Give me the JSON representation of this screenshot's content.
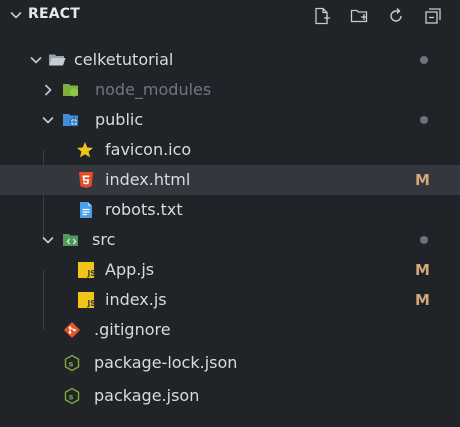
{
  "explorer": {
    "title": "REACT",
    "actions": [
      {
        "name": "new-file-icon"
      },
      {
        "name": "new-folder-icon"
      },
      {
        "name": "refresh-icon"
      },
      {
        "name": "collapse-all-icon"
      }
    ]
  },
  "tree": {
    "root": {
      "label": "celketutorial",
      "icon": "folder-icon",
      "status": "dot"
    },
    "node_modules": {
      "label": "node_modules",
      "icon": "node-folder-icon"
    },
    "public": {
      "label": "public",
      "icon": "public-folder-icon",
      "status": "dot"
    },
    "favicon": {
      "label": "favicon.ico",
      "icon": "star-icon"
    },
    "index_html": {
      "label": "index.html",
      "icon": "html5-icon",
      "badge": "M"
    },
    "robots": {
      "label": "robots.txt",
      "icon": "text-file-icon"
    },
    "src": {
      "label": "src",
      "icon": "src-folder-icon",
      "status": "dot"
    },
    "app_js": {
      "label": "App.js",
      "icon": "javascript-icon",
      "badge": "M",
      "icon_text": "JS"
    },
    "index_js": {
      "label": "index.js",
      "icon": "javascript-icon",
      "badge": "M",
      "icon_text": "JS"
    },
    "gitignore": {
      "label": ".gitignore",
      "icon": "git-icon"
    },
    "package_lock": {
      "label": "package-lock.json",
      "icon": "nodejs-icon"
    },
    "package_json": {
      "label": "package.json",
      "icon": "nodejs-icon"
    }
  },
  "colors": {
    "background": "#202327",
    "selected_row": "#34383e",
    "modified_badge": "#d2a87a",
    "html_icon": "#e34c26",
    "js_icon": "#f0c419",
    "git_icon": "#e8532a",
    "folder_icon": "#c7cdd4"
  }
}
